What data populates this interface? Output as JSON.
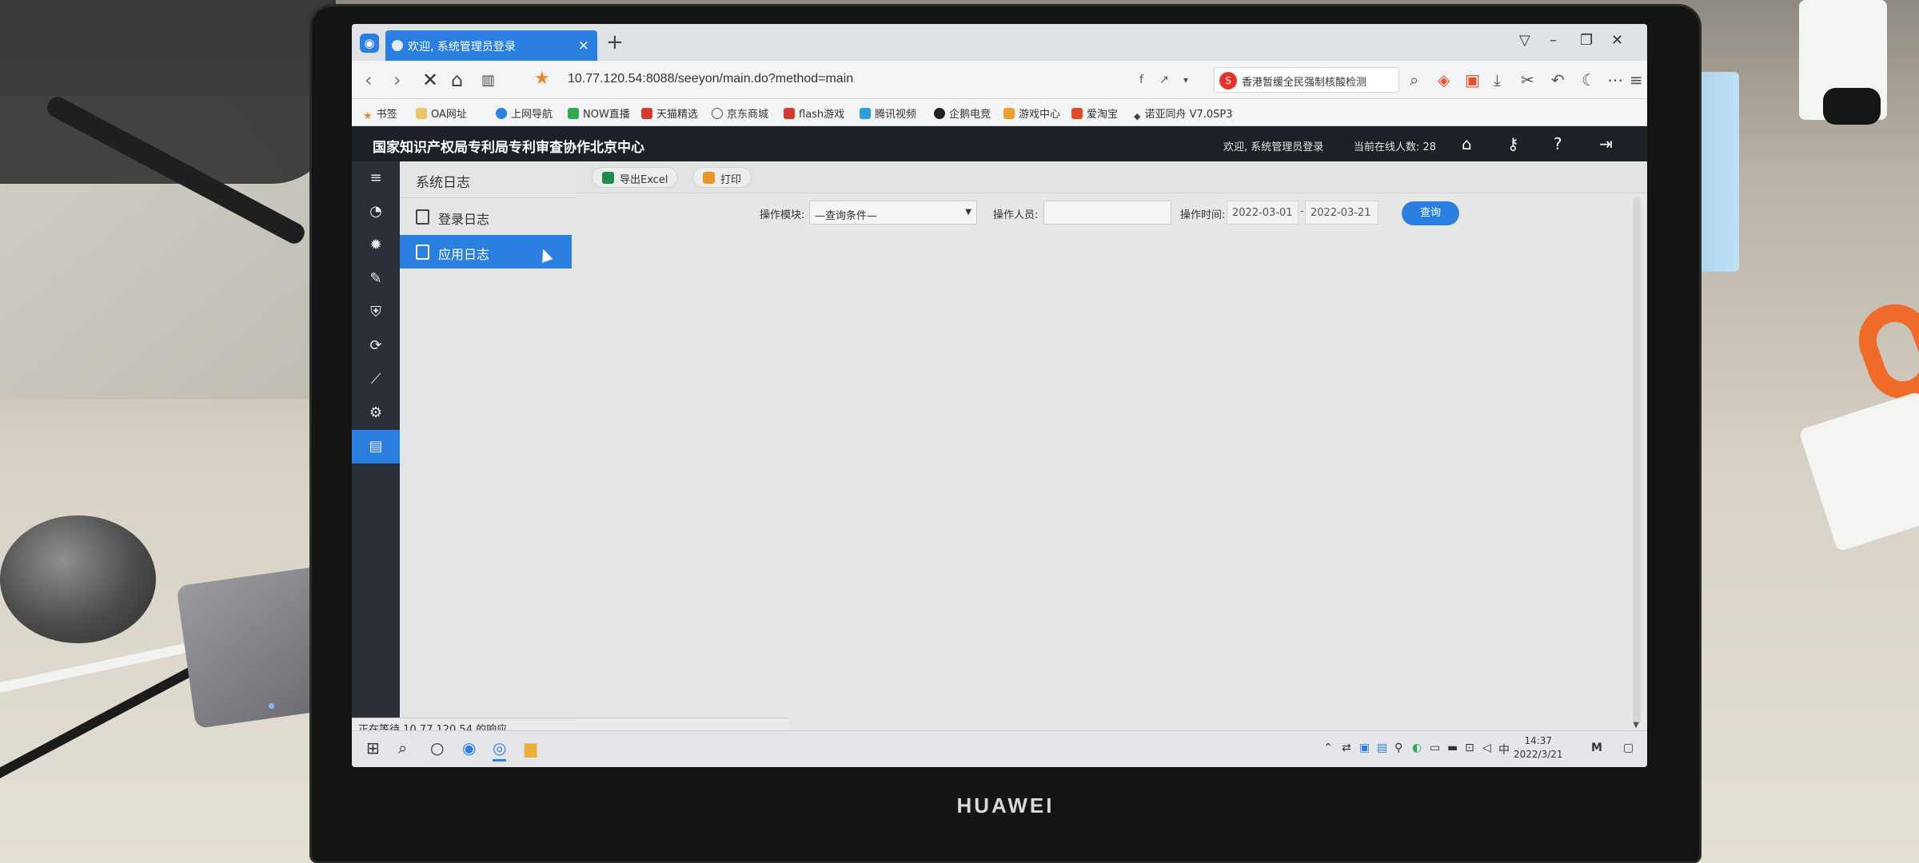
{
  "browser": {
    "tab_title": "欢迎, 系统管理员登录",
    "tab_close": "×",
    "new_tab": "+",
    "url": "10.77.120.54:8088/seeyon/main.do?method=main",
    "search_text": "香港暂缓全民强制核酸检测",
    "bookmarks": [
      "书签",
      "OA网址",
      "上网导航",
      "NOW直播",
      "天猫精选",
      "京东商城",
      "flash游戏",
      "腾讯视频",
      "企鹅电竞",
      "游戏中心",
      "爱淘宝",
      "诺亚同舟 V7.0SP3"
    ]
  },
  "app": {
    "title": "国家知识产权局专利局专利审查协作北京中心",
    "welcome": "欢迎, 系统管理员登录",
    "online_users": "当前在线人数: 28"
  },
  "menu": {
    "title": "系统日志",
    "items": [
      "登录日志",
      "应用日志"
    ],
    "active_index": 1
  },
  "toolbar": {
    "export_label": "导出Excel",
    "print_label": "打印"
  },
  "filters": {
    "module_label": "操作模块:",
    "module_value": "—查询条件—",
    "operator_label": "操作人员:",
    "operator_value": "",
    "time_label": "操作时间:",
    "date_from": "2022-03-01",
    "date_sep": "-",
    "date_to": "2022-03-21",
    "query_label": "查询"
  },
  "status": {
    "text": "正在等待 10.77.120.54 的响应..."
  },
  "taskbar": {
    "ime": "中",
    "time": "14:37",
    "date": "2022/3/21"
  },
  "monitor": {
    "brand": "HUAWEI"
  },
  "colors": {
    "accent": "#2a7fe0",
    "header_bg": "#1c2127",
    "rail_bg": "#2b3038"
  }
}
